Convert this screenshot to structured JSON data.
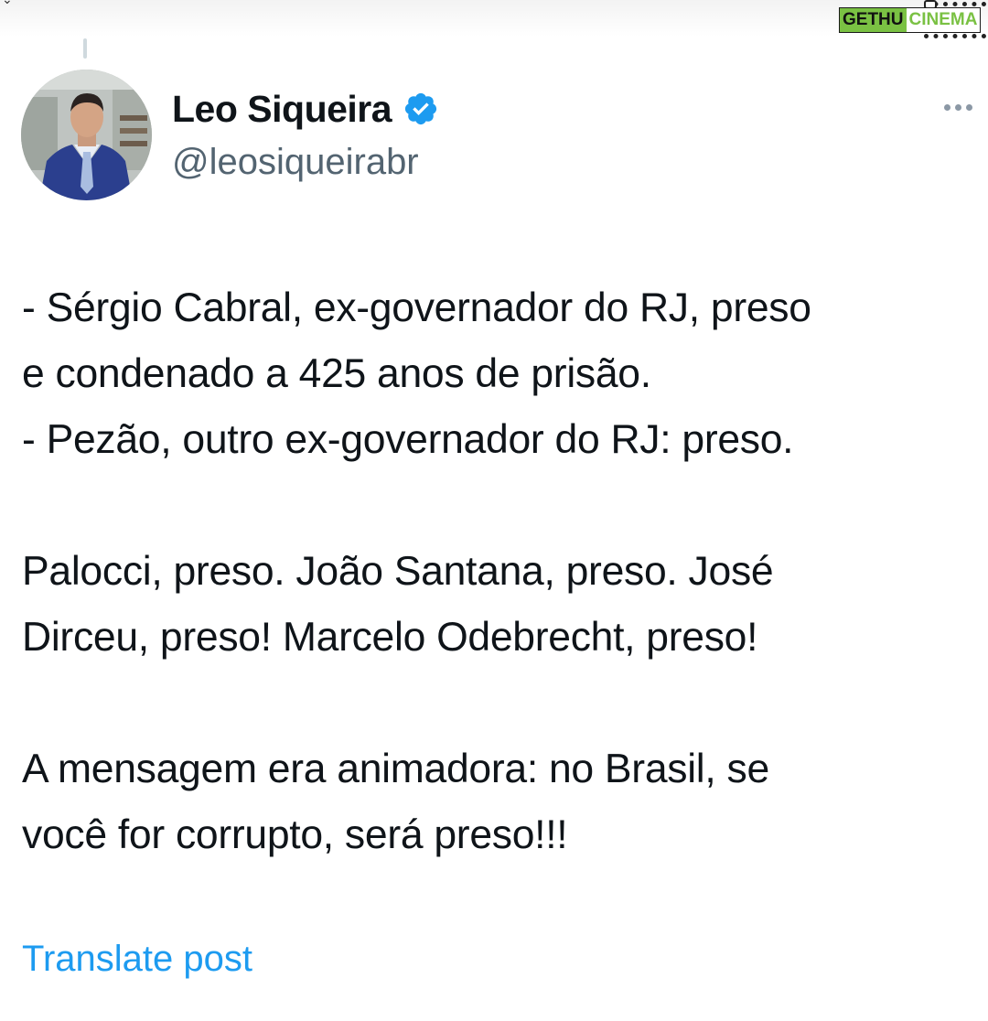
{
  "watermark": {
    "part1": "GETHU",
    "part2": "CINEMA"
  },
  "tweet": {
    "author": {
      "display_name": "Leo Siqueira",
      "handle": "@leosiqueirabr",
      "verified": true,
      "avatar_icon": "profile-photo"
    },
    "more_icon": "ellipsis-icon",
    "body_lines": [
      "- Sérgio Cabral, ex-governador do RJ, preso",
      "e condenado a 425 anos de prisão.",
      "- Pezão, outro ex-governador do RJ: preso.",
      "",
      "Palocci, preso. João Santana, preso. José",
      "Dirceu, preso! Marcelo Odebrecht, preso!",
      "",
      "A mensagem era animadora: no Brasil, se",
      "você for corrupto, será preso!!!"
    ],
    "translate_label": "Translate post"
  },
  "colors": {
    "text_primary": "#0f1419",
    "text_secondary": "#536471",
    "link": "#1d9bf0",
    "verified_badge": "#1d9bf0"
  }
}
